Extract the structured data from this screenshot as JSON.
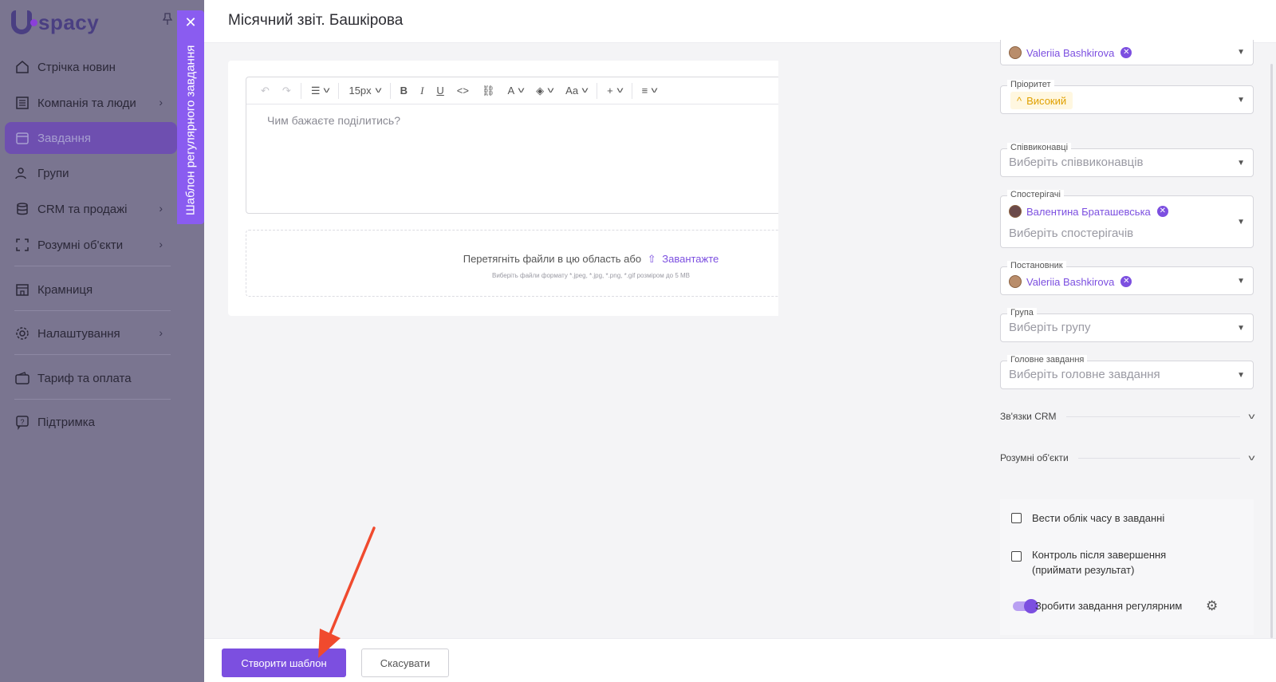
{
  "sidebar": {
    "logo_text": "spacy",
    "items": [
      {
        "label": "Стрічка новин",
        "icon": "home-icon",
        "has_chevron": false
      },
      {
        "label": "Компанія та люди",
        "icon": "company-icon",
        "has_chevron": true
      },
      {
        "label": "Завдання",
        "icon": "calendar-icon",
        "has_chevron": false,
        "active": true
      },
      {
        "label": "Групи",
        "icon": "groups-icon",
        "has_chevron": false
      },
      {
        "label": "CRM та продажі",
        "icon": "crm-icon",
        "has_chevron": true
      },
      {
        "label": "Розумні об'єкти",
        "icon": "smart-objects-icon",
        "has_chevron": true
      },
      {
        "label": "Крамниця",
        "icon": "store-icon",
        "has_chevron": false
      },
      {
        "label": "Налаштування",
        "icon": "gear-icon",
        "has_chevron": true
      },
      {
        "label": "Тариф та оплата",
        "icon": "wallet-icon",
        "has_chevron": false
      },
      {
        "label": "Підтримка",
        "icon": "support-icon",
        "has_chevron": false
      }
    ]
  },
  "vertical_tab": {
    "label": "Шаблон регулярного завдання",
    "close": "✕"
  },
  "header": {
    "title": "Місячний звіт. Башкірова"
  },
  "editor": {
    "font_size": "15px",
    "placeholder": "Чим бажаєте поділитись?",
    "toolbar": {
      "bold": "B",
      "italic": "I",
      "underline": "U",
      "code": "<>",
      "font_color": "A",
      "case": "Aa",
      "insert": "+"
    }
  },
  "dropzone": {
    "text": "Перетягніть файли в цю область або",
    "upload_link": "Завантажте",
    "hint": "Виберіть файли формату *.jpeg, *.jpg, *.png, *.gif розміром до 5 MB"
  },
  "right_panel": {
    "assignee": {
      "chip": "Valeriia Bashkirova"
    },
    "priority": {
      "label": "Пріоритет",
      "value": "Високий"
    },
    "coexecutors": {
      "label": "Співвиконавці",
      "placeholder": "Виберіть співвиконавців"
    },
    "observers": {
      "label": "Спостерігачі",
      "chip": "Валентина Браташевська",
      "placeholder": "Виберіть спостерігачів"
    },
    "creator": {
      "label": "Постановник",
      "chip": "Valeriia Bashkirova"
    },
    "group": {
      "label": "Група",
      "placeholder": "Виберіть групу"
    },
    "parent_task": {
      "label": "Головне завдання",
      "placeholder": "Виберіть головне завдання"
    },
    "crm_links": "Зв'язки CRM",
    "smart_objects": "Розумні об'єкти",
    "options": {
      "time_tracking": "Вести облік часу в завданні",
      "control_line1": "Контроль після завершення",
      "control_line2": "(приймати результат)",
      "make_regular": "Зробити завдання регулярним",
      "make_regular_on": true
    }
  },
  "footer": {
    "create_label": "Створити шаблон",
    "cancel_label": "Скасувати"
  },
  "colors": {
    "accent": "#7c4fe0",
    "priority": "#e0a000"
  }
}
